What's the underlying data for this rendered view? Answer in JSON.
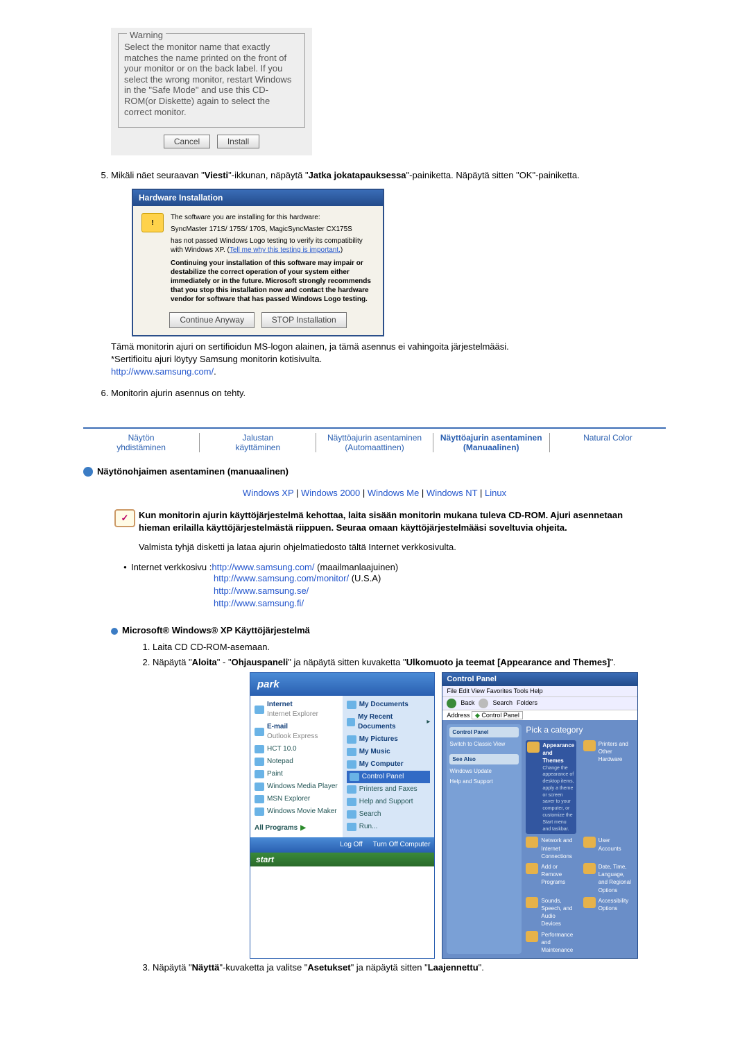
{
  "warning": {
    "legend": "Warning",
    "text": "Select the monitor name that exactly matches the name printed on the front of your monitor or on the back label. If you select the wrong monitor, restart Windows in the \"Safe Mode\" and use this CD-ROM(or Diskette) again to select the correct monitor.",
    "cancel": "Cancel",
    "install": "Install"
  },
  "step5": {
    "prefix": "Mikäli näet seuraavan \"",
    "word1": "Viesti",
    "mid": "\"-ikkunan, näpäytä \"",
    "word2": "Jatka jokatapauksessa",
    "suffix": "\"-painiketta. Näpäytä sitten \"OK\"-painiketta."
  },
  "hw": {
    "title": "Hardware Installation",
    "line1": "The software you are installing for this hardware:",
    "line2": "SyncMaster 171S/ 175S/ 170S, MagicSyncMaster CX175S",
    "line3a": "has not passed Windows Logo testing to verify its compatibility with Windows XP. (",
    "line3link": "Tell me why this testing is important.",
    "line3b": ")",
    "line4": "Continuing your installation of this software may impair or destabilize the correct operation of your system either immediately or in the future. Microsoft strongly recommends that you stop this installation now and contact the hardware vendor for software that has passed Windows Logo testing.",
    "btn_cont": "Continue Anyway",
    "btn_stop": "STOP Installation"
  },
  "after5": {
    "line1": "Tämä monitorin ajuri on sertifioidun MS-logon alainen, ja tämä asennus ei vahingoita järjestelmääsi.",
    "line2": "*Sertifioitu ajuri löytyy Samsung monitorin kotisivulta.",
    "url": "http://www.samsung.com/",
    "dot": "."
  },
  "step6": "Monitorin ajurin asennus on tehty.",
  "tabs": {
    "t1a": "Näytön",
    "t1b": "yhdistäminen",
    "t2a": "Jalustan",
    "t2b": "käyttäminen",
    "t3a": "Näyttöajurin asentaminen",
    "t3b": "(Automaattinen)",
    "t4a": "Näyttöajurin asentaminen",
    "t4b": "(Manuaalinen)",
    "t5": "Natural Color"
  },
  "section_title": "Näytönohjaimen asentaminen (manuaalinen)",
  "oslinks": {
    "xp": "Windows XP",
    "w2000": "Windows 2000",
    "wme": "Windows Me",
    "wnt": "Windows NT",
    "linux": "Linux"
  },
  "note": {
    "l1": "Kun monitorin ajurin käyttöjärjestelmä kehottaa, laita sisään monitorin mukana tuleva CD-ROM. Ajuri asennetaan hieman erilailla käyttöjärjestelmästä riippuen. Seuraa omaan käyttöjärjestelmääsi soveltuvia ohjeita.",
    "l2": "Valmista tyhjä disketti ja lataa ajurin ohjelmatiedosto tältä Internet verkkosivulta."
  },
  "links": {
    "label": "Internet verkkosivu :",
    "u1": "http://www.samsung.com/",
    "u1_sfx": " (maailmanlaajuinen)",
    "u2": "http://www.samsung.com/monitor/",
    "u2_sfx": " (U.S.A)",
    "u3": "http://www.samsung.se/",
    "u4": "http://www.samsung.fi/"
  },
  "xp_head": "Microsoft® Windows® XP Käyttöjärjestelmä",
  "xp_steps": {
    "s1": "Laita CD CD-ROM-asemaan.",
    "s2_a": "Näpäytä \"",
    "s2_b": "Aloita",
    "s2_c": "\" - \"",
    "s2_d": "Ohjauspaneli",
    "s2_e": "\" ja näpäytä sitten kuvaketta \"",
    "s2_f": "Ulkomuoto ja teemat [Appearance and Themes]",
    "s2_g": "\".",
    "s3_a": "Näpäytä \"",
    "s3_b": "Näyttä",
    "s3_c": "\"-kuvaketta ja valitse \"",
    "s3_d": "Asetukset",
    "s3_e": "\" ja näpäytä sitten \"",
    "s3_f": "Laajennettu",
    "s3_g": "\"."
  },
  "startmenu": {
    "user": "park",
    "left": [
      "Internet",
      "Internet Explorer",
      "E-mail",
      "Outlook Express",
      "HCT 10.0",
      "Notepad",
      "Paint",
      "Windows Media Player",
      "MSN Explorer",
      "Windows Movie Maker"
    ],
    "allprograms": "All Programs",
    "right": [
      "My Documents",
      "My Recent Documents",
      "My Pictures",
      "My Music",
      "My Computer",
      "Control Panel",
      "Printers and Faxes",
      "Help and Support",
      "Search",
      "Run..."
    ],
    "logoff": "Log Off",
    "turnoff": "Turn Off Computer",
    "start": "start"
  },
  "cpanel": {
    "title": "Control Panel",
    "menu": "File   Edit   View   Favorites   Tools   Help",
    "back": "Back",
    "search": "Search",
    "folders": "Folders",
    "addr_label": "Address",
    "addr": "Control Panel",
    "side_cp": "Control Panel",
    "side_switch": "Switch to Classic View",
    "side_see": "See Also",
    "side_wu": "Windows Update",
    "side_hs": "Help and Support",
    "pick": "Pick a category",
    "cats": {
      "c1": "Appearance and Themes",
      "c1_sub": "Change the appearance of desktop items, apply a theme or screen saver to your computer, or customize the Start menu and taskbar.",
      "c2": "Printers and Other Hardware",
      "c3": "Network and Internet Connections",
      "c4": "User Accounts",
      "c5": "Add or Remove Programs",
      "c6": "Date, Time, Language, and Regional Options",
      "c7": "Sounds, Speech, and Audio Devices",
      "c8": "Accessibility Options",
      "c9": "Performance and Maintenance"
    }
  }
}
